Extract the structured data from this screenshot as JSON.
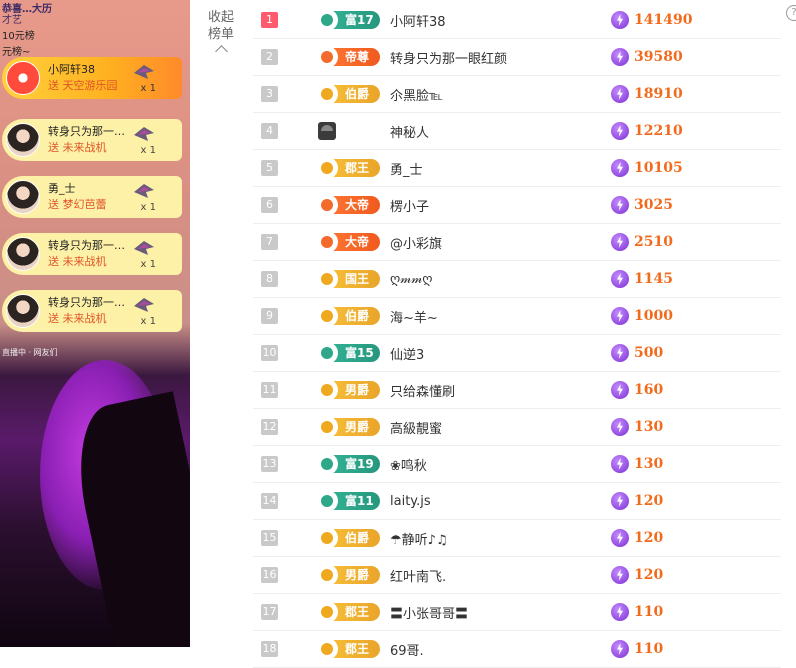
{
  "stage": {
    "top_text_lines": [
      "恭喜…大历",
      "才艺",
      "10元榜",
      "元榜~"
    ],
    "stream_meta": "直播中 · 网友们",
    "gifts": [
      {
        "name": "小阿轩38",
        "action": "送",
        "gift": "天空游乐园",
        "count": "x 1",
        "highlight": true
      },
      {
        "name": "转身只为那一…",
        "action": "送",
        "gift": "未来战机",
        "count": "x 1",
        "highlight": false
      },
      {
        "name": "勇_士",
        "action": "送",
        "gift": "梦幻芭蕾",
        "count": "x 1",
        "highlight": false
      },
      {
        "name": "转身只为那一…",
        "action": "送",
        "gift": "未来战机",
        "count": "x 1",
        "highlight": false
      },
      {
        "name": "转身只为那一…",
        "action": "送",
        "gift": "未来战机",
        "count": "x 1",
        "highlight": false
      }
    ]
  },
  "collapse": {
    "line1": "收起",
    "line2": "榜单"
  },
  "help_icon": "?",
  "colors": {
    "rank_first": "#ff5a6e",
    "coins": "#f26b1d",
    "gold_badge": "#f0a81e",
    "orange_badge": "#f26a2c",
    "teal_badge": "#2ea888"
  },
  "leaderboard": [
    {
      "rank": "1",
      "badge": "富17",
      "badge_style": "teal",
      "name": "小阿轩38",
      "coins": "141490"
    },
    {
      "rank": "2",
      "badge": "帝尊",
      "badge_style": "orange",
      "name": "转身只为那一眼红颜",
      "coins": "39580"
    },
    {
      "rank": "3",
      "badge": "伯爵",
      "badge_style": "gold",
      "name": "尒黑脸℡",
      "coins": "18910"
    },
    {
      "rank": "4",
      "badge": "",
      "badge_style": "mystery",
      "name": "神秘人",
      "coins": "12210"
    },
    {
      "rank": "5",
      "badge": "郡王",
      "badge_style": "gold",
      "name": "勇_士",
      "coins": "10105"
    },
    {
      "rank": "6",
      "badge": "大帝",
      "badge_style": "orange",
      "name": "楞小子",
      "coins": "3025"
    },
    {
      "rank": "7",
      "badge": "大帝",
      "badge_style": "orange",
      "name": "@小彩旗",
      "coins": "2510"
    },
    {
      "rank": "8",
      "badge": "国王",
      "badge_style": "gold",
      "name": "ღ𝓂𝓂ღ",
      "coins": "1145"
    },
    {
      "rank": "9",
      "badge": "伯爵",
      "badge_style": "gold",
      "name": "海~羊~",
      "coins": "1000"
    },
    {
      "rank": "10",
      "badge": "富15",
      "badge_style": "teal",
      "name": "仙逆3",
      "coins": "500"
    },
    {
      "rank": "11",
      "badge": "男爵",
      "badge_style": "gold",
      "name": "只给森懂刷",
      "coins": "160"
    },
    {
      "rank": "12",
      "badge": "男爵",
      "badge_style": "gold",
      "name": "高級靚蜜",
      "coins": "130"
    },
    {
      "rank": "13",
      "badge": "富19",
      "badge_style": "teal",
      "name": "❀鸣秋",
      "coins": "130"
    },
    {
      "rank": "14",
      "badge": "富11",
      "badge_style": "teal",
      "name": "laity.js",
      "coins": "120"
    },
    {
      "rank": "15",
      "badge": "伯爵",
      "badge_style": "gold",
      "name": "☂静听♪♫",
      "coins": "120"
    },
    {
      "rank": "16",
      "badge": "男爵",
      "badge_style": "gold",
      "name": "红叶南飞.",
      "coins": "120"
    },
    {
      "rank": "17",
      "badge": "郡王",
      "badge_style": "gold",
      "name": "〓小张哥哥〓",
      "coins": "110"
    },
    {
      "rank": "18",
      "badge": "郡王",
      "badge_style": "gold",
      "name": "69哥.",
      "coins": "110"
    }
  ]
}
